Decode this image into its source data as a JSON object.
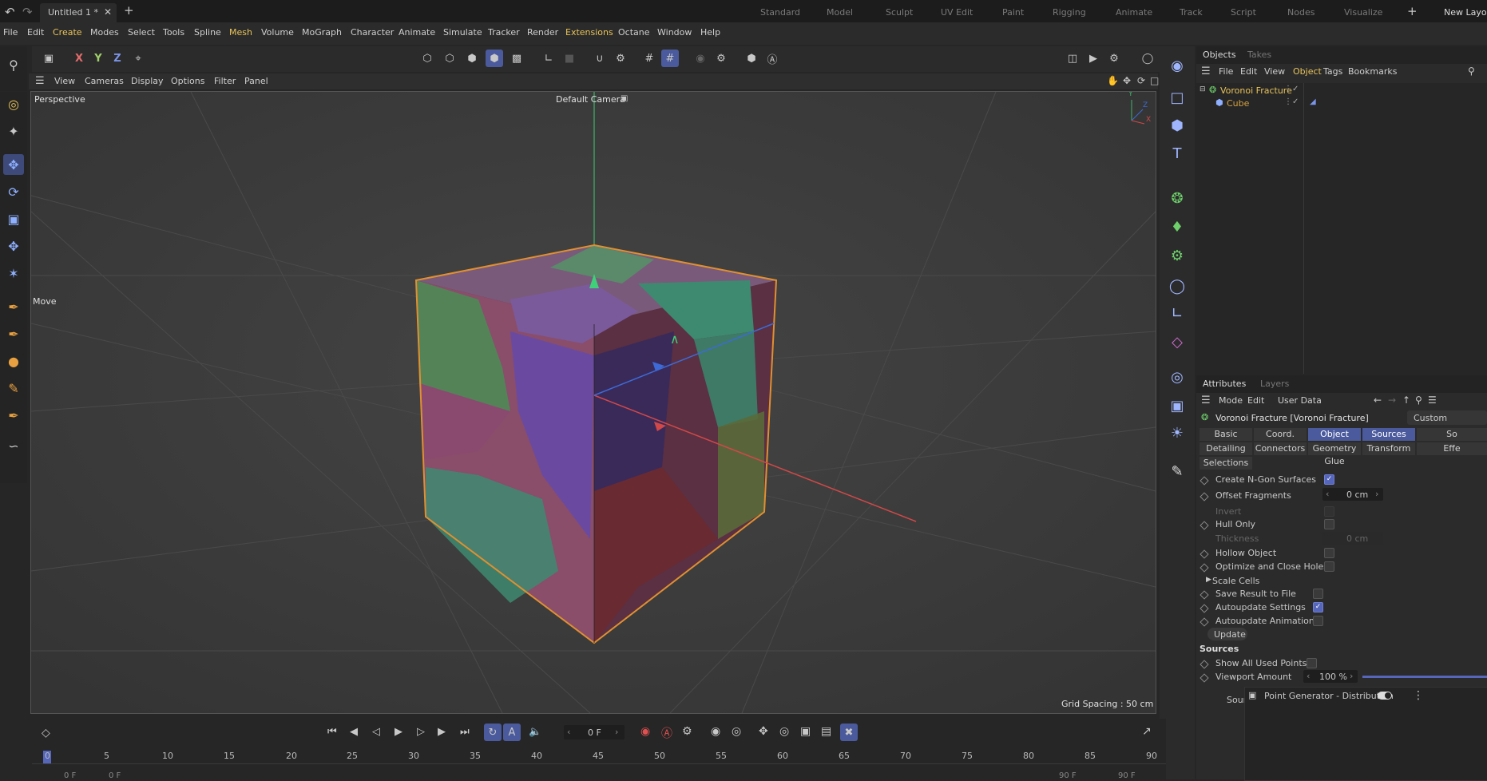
{
  "titlebar": {
    "doc_tab": "Untitled 1 *",
    "workspaces": [
      "Standard",
      "Model",
      "Sculpt",
      "UV Edit",
      "Paint",
      "Rigging",
      "Animate",
      "Track",
      "Script",
      "Nodes",
      "Visualize"
    ],
    "new_layout": "New Layou"
  },
  "menu": [
    "File",
    "Edit",
    "Create",
    "Modes",
    "Select",
    "Tools",
    "Spline",
    "Mesh",
    "Volume",
    "MoGraph",
    "Character",
    "Animate",
    "Simulate",
    "Tracker",
    "Render",
    "Extensions",
    "Octane",
    "Window",
    "Help"
  ],
  "axes_buttons": {
    "x": "X",
    "y": "Y",
    "z": "Z"
  },
  "viewport_menu": [
    "View",
    "Cameras",
    "Display",
    "Options",
    "Filter",
    "Panel"
  ],
  "viewport": {
    "projection": "Perspective",
    "camera": "Default Camera",
    "tool_label": "Move",
    "grid_spacing": "Grid Spacing : 50 cm",
    "axis_y": "Y",
    "axis_z": "Z",
    "axis_x": "X"
  },
  "objects_panel": {
    "tabs": [
      "Objects",
      "Takes"
    ],
    "menu": [
      "File",
      "Edit",
      "View",
      "Object",
      "Tags",
      "Bookmarks"
    ],
    "items": [
      {
        "name": "Voronoi Fracture",
        "color": "#e8c35a"
      },
      {
        "name": "Cube",
        "color": "#d2a040"
      }
    ]
  },
  "attributes_panel": {
    "tabs": [
      "Attributes",
      "Layers"
    ],
    "menu": [
      "Mode",
      "Edit",
      "User Data"
    ],
    "object_title": "Voronoi Fracture [Voronoi Fracture]",
    "custom_btn": "Custom",
    "tabs_row1": [
      "Basic",
      "Coord.",
      "Object",
      "Sources",
      "So"
    ],
    "tabs_row2": [
      "Detailing",
      "Connectors",
      "Geometry Glue",
      "Transform",
      "Effe"
    ],
    "tabs_row3": [
      "Selections"
    ],
    "props": {
      "create_ngon": "Create N-Gon Surfaces",
      "offset_fragments": "Offset Fragments",
      "offset_value": "0 cm",
      "invert": "Invert",
      "hull_only": "Hull Only",
      "thickness": "Thickness",
      "thickness_value": "0 cm",
      "hollow_object": "Hollow Object",
      "optimize": "Optimize and Close Holes",
      "scale_cells": "Scale Cells",
      "save_result": "Save Result to File",
      "autoupdate_settings": "Autoupdate Settings",
      "autoupdate_animation": "Autoupdate Animation",
      "update_btn": "Update",
      "sources_header": "Sources",
      "show_all_points": "Show All Used Points",
      "viewport_amount": "Viewport Amount",
      "viewport_amount_value": "100 %",
      "sources_label": "Sources",
      "source_item": "Point Generator - Distribution"
    }
  },
  "timeline": {
    "current_frame": "0 F",
    "ticks": [
      "0",
      "5",
      "10",
      "15",
      "20",
      "25",
      "30",
      "35",
      "40",
      "45",
      "50",
      "55",
      "60",
      "65",
      "70",
      "75",
      "80",
      "85",
      "90"
    ],
    "start_field": "0 F",
    "start_field2": "0 F",
    "end_field": "90 F",
    "end_field2": "90 F"
  }
}
